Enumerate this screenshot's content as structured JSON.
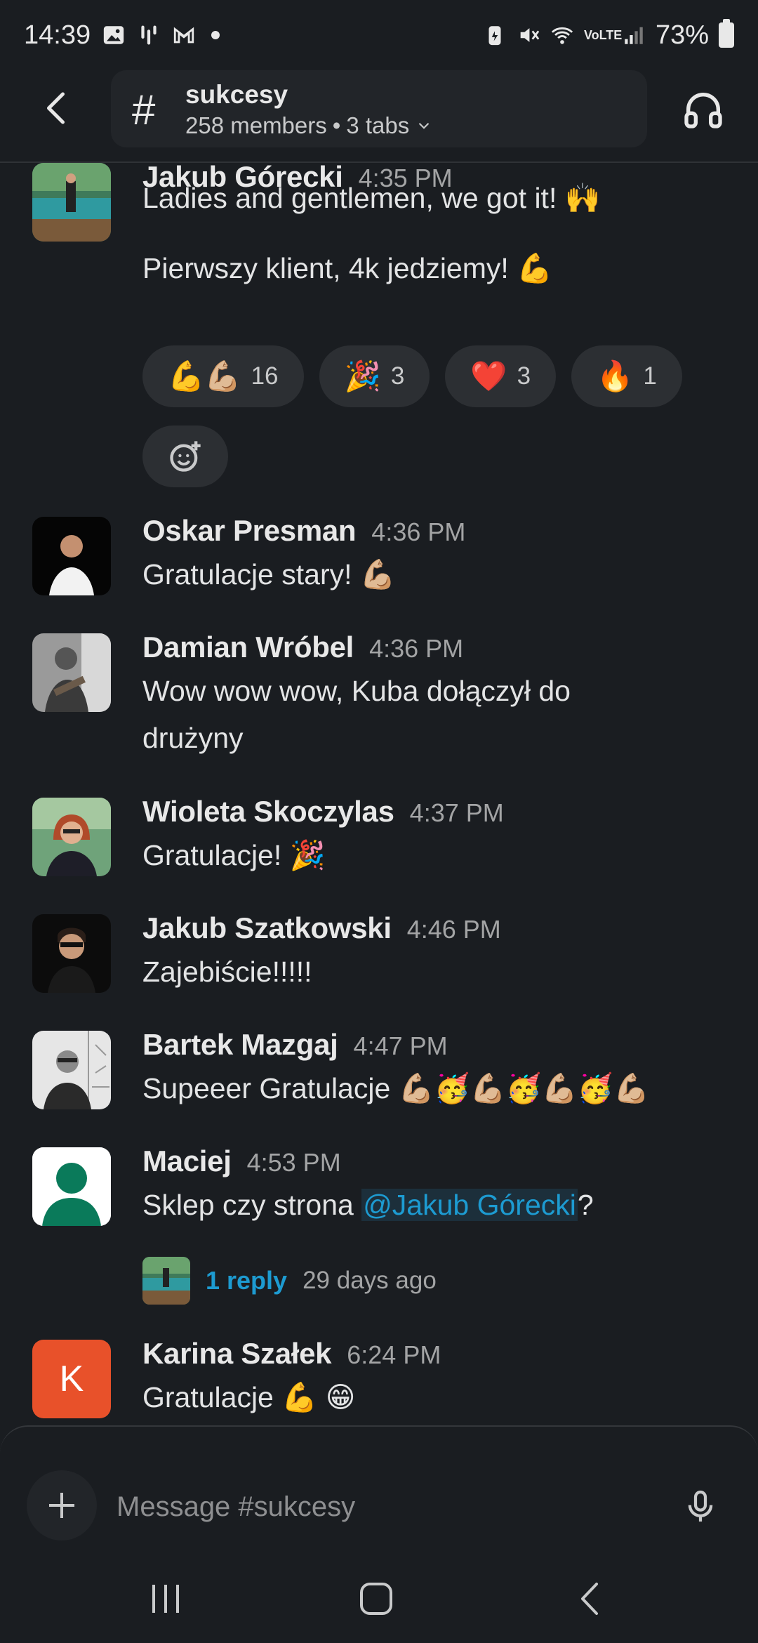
{
  "status_bar": {
    "time": "14:39",
    "battery": "73%",
    "network": "VoLTE"
  },
  "header": {
    "channel_name": "sukcesy",
    "members": "258 members",
    "tabs": "3 tabs",
    "hash": "#"
  },
  "messages": [
    {
      "name": "Jakub Górecki",
      "time": "4:35 PM",
      "lines": [
        "Ladies and gentlemen, we got it! 🙌",
        "Pierwszy klient, 4k jedziemy! 💪"
      ],
      "reactions": [
        {
          "emoji": "💪💪🏼",
          "count": "16"
        },
        {
          "emoji": "🎉",
          "count": "3"
        },
        {
          "emoji": "❤️",
          "count": "3"
        },
        {
          "emoji": "🔥",
          "count": "1"
        }
      ]
    },
    {
      "name": "Oskar Presman",
      "time": "4:36 PM",
      "text": "Gratulacje stary! 💪🏼"
    },
    {
      "name": "Damian Wróbel",
      "time": "4:36 PM",
      "text": "Wow wow wow, Kuba dołączył do drużyny"
    },
    {
      "name": "Wioleta Skoczylas",
      "time": "4:37 PM",
      "text": "Gratulacje! 🎉"
    },
    {
      "name": "Jakub Szatkowski",
      "time": "4:46 PM",
      "text": "Zajebiście!!!!!"
    },
    {
      "name": "Bartek Mazgaj",
      "time": "4:47 PM",
      "text": "Supeeer Gratulacje 💪🏼🥳💪🏼🥳💪🏼🥳💪🏼"
    },
    {
      "name": "Maciej",
      "time": "4:53 PM",
      "text_before": "Sklep czy strona ",
      "mention": "@Jakub Górecki",
      "text_after": "?",
      "thread": {
        "replies": "1 reply",
        "when": "29 days ago"
      }
    },
    {
      "name": "Karina Szałek",
      "time": "6:24 PM",
      "text": "Gratulacje 💪 😁",
      "avatar_letter": "K"
    }
  ],
  "composer": {
    "placeholder": "Message #sukcesy"
  },
  "colors": {
    "background": "#1a1d21",
    "link": "#1d9bd1",
    "karina_avatar": "#e8512a",
    "maciej_avatar": "#0a7a5a"
  }
}
